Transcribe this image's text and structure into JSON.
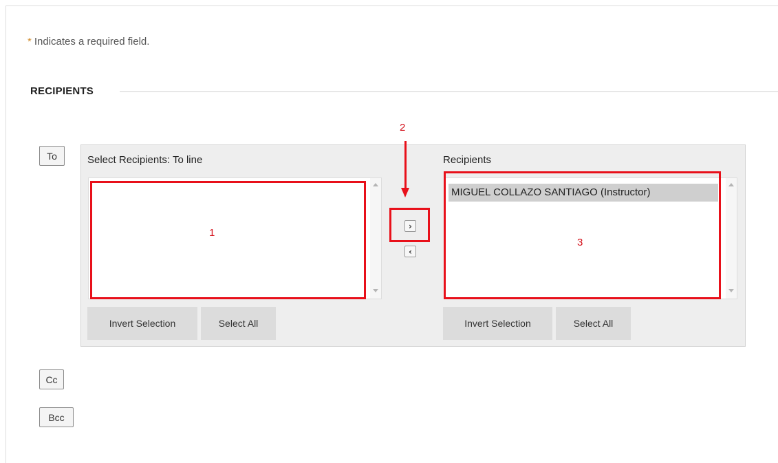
{
  "form": {
    "required_star": "*",
    "required_note": "Indicates a required field."
  },
  "recipients_section": {
    "title": "RECIPIENTS"
  },
  "fields": {
    "to_label": "To",
    "cc_label": "Cc",
    "bcc_label": "Bcc"
  },
  "picker": {
    "left_label": "Select Recipients: To line",
    "right_label": "Recipients",
    "left_items": [],
    "right_items": [
      {
        "label": "MIGUEL COLLAZO SANTIAGO (Instructor)",
        "selected": true
      }
    ],
    "move_right_glyph": "›",
    "move_left_glyph": "‹",
    "invert_label": "Invert Selection",
    "select_all_label": "Select All"
  },
  "annotations": {
    "color": "#e8101a",
    "labels": [
      "1",
      "2",
      "3"
    ]
  }
}
